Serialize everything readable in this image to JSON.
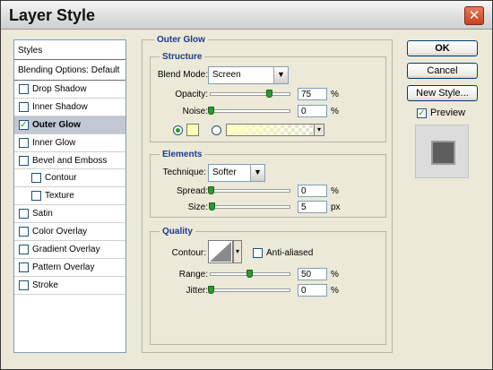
{
  "window": {
    "title": "Layer Style",
    "close_glyph": "✕"
  },
  "styles_panel": {
    "header": "Styles",
    "blending": "Blending Options: Default",
    "items": [
      {
        "label": "Drop Shadow",
        "checked": false,
        "sub": false,
        "selected": false
      },
      {
        "label": "Inner Shadow",
        "checked": false,
        "sub": false,
        "selected": false
      },
      {
        "label": "Outer Glow",
        "checked": true,
        "sub": false,
        "selected": true
      },
      {
        "label": "Inner Glow",
        "checked": false,
        "sub": false,
        "selected": false
      },
      {
        "label": "Bevel and Emboss",
        "checked": false,
        "sub": false,
        "selected": false
      },
      {
        "label": "Contour",
        "checked": false,
        "sub": true,
        "selected": false
      },
      {
        "label": "Texture",
        "checked": false,
        "sub": true,
        "selected": false
      },
      {
        "label": "Satin",
        "checked": false,
        "sub": false,
        "selected": false
      },
      {
        "label": "Color Overlay",
        "checked": false,
        "sub": false,
        "selected": false
      },
      {
        "label": "Gradient Overlay",
        "checked": false,
        "sub": false,
        "selected": false
      },
      {
        "label": "Pattern Overlay",
        "checked": false,
        "sub": false,
        "selected": false
      },
      {
        "label": "Stroke",
        "checked": false,
        "sub": false,
        "selected": false
      }
    ]
  },
  "outer_glow": {
    "title": "Outer Glow",
    "structure": {
      "title": "Structure",
      "blend_mode_label": "Blend Mode:",
      "blend_mode_value": "Screen",
      "opacity_label": "Opacity:",
      "opacity_value": "75",
      "opacity_percent": 75,
      "opacity_unit": "%",
      "noise_label": "Noise:",
      "noise_value": "0",
      "noise_percent": 0,
      "noise_unit": "%",
      "glow_color": "#ffffb0"
    },
    "elements": {
      "title": "Elements",
      "technique_label": "Technique:",
      "technique_value": "Softer",
      "spread_label": "Spread:",
      "spread_value": "0",
      "spread_percent": 0,
      "spread_unit": "%",
      "size_label": "Size:",
      "size_value": "5",
      "size_percent": 2,
      "size_unit": "px"
    },
    "quality": {
      "title": "Quality",
      "contour_label": "Contour:",
      "anti_aliased_label": "Anti-aliased",
      "anti_aliased": false,
      "range_label": "Range:",
      "range_value": "50",
      "range_percent": 50,
      "range_unit": "%",
      "jitter_label": "Jitter:",
      "jitter_value": "0",
      "jitter_percent": 0,
      "jitter_unit": "%"
    }
  },
  "buttons": {
    "ok": "OK",
    "cancel": "Cancel",
    "new_style": "New Style..."
  },
  "preview": {
    "label": "Preview",
    "checked": true
  },
  "icons": {
    "checkmark": "✓",
    "dropdown": "▼",
    "dropdown_small": "▾"
  }
}
